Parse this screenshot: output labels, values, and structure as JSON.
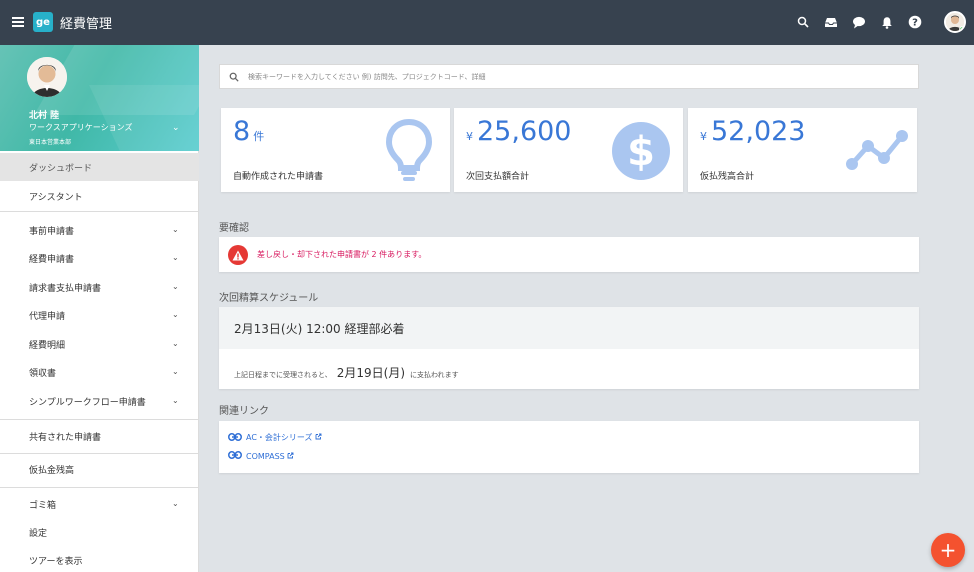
{
  "app": {
    "logo": "ge",
    "title": "経費管理"
  },
  "topbar_icons": [
    "search-icon",
    "inbox-icon",
    "chat-icon",
    "bell-icon",
    "help-icon"
  ],
  "user": {
    "name": "北村 陸",
    "company": "ワークスアプリケーションズ",
    "department": "東日本営業本部"
  },
  "nav": {
    "dashboard": "ダッシュボード",
    "assistant": "アシスタント",
    "pre_application": "事前申請書",
    "expense_application": "経費申請書",
    "invoice_payment": "請求書支払申請書",
    "proxy_application": "代理申請",
    "expense_details": "経費明細",
    "receipts": "領収書",
    "simple_workflow": "シンプルワークフロー申請書",
    "shared_applications": "共有された申請書",
    "advance_balance": "仮払金残高",
    "trash": "ゴミ箱",
    "settings": "設定",
    "show_tour": "ツアーを表示"
  },
  "search": {
    "placeholder": "検索キーワードを入力してください 例) 訪問先、プロジェクトコード、詳細"
  },
  "cards": {
    "auto_created": {
      "value": "8",
      "unit": "件",
      "caption": "自動作成された申請書"
    },
    "next_payment": {
      "currency": "¥",
      "value": "25,600",
      "caption": "次回支払額合計"
    },
    "advance_balance": {
      "currency": "¥",
      "value": "52,023",
      "caption": "仮払残高合計"
    }
  },
  "confirmation": {
    "title": "要確認",
    "alert": "差し戻し・却下された申請書が 2 件あります。"
  },
  "schedule": {
    "title": "次回精算スケジュール",
    "deadline": "2月13日(火) 12:00 経理部必着",
    "note_prefix": "上記日程までに受理されると、",
    "payment_date": "2月19日(月)",
    "note_suffix": "に支払われます"
  },
  "links": {
    "title": "関連リンク",
    "items": [
      "AC・会計シリーズ",
      "COMPASS"
    ]
  },
  "colors": {
    "topbar": "#37424f",
    "accent": "#3977d6",
    "alert": "#e53935",
    "fab": "#f4522f",
    "profile_bg": "#40b8a7"
  }
}
